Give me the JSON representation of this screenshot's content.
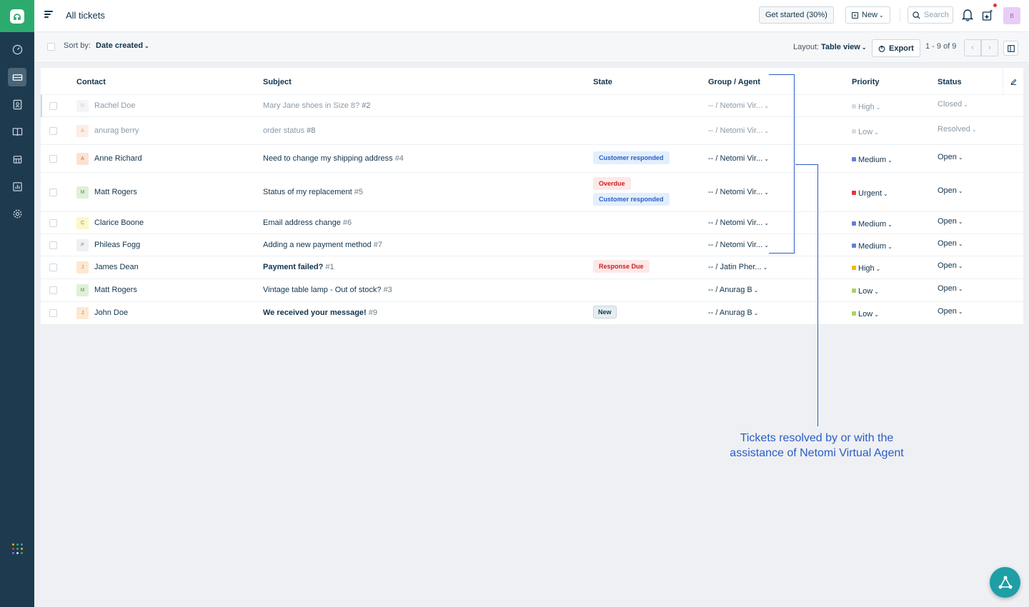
{
  "header": {
    "title": "All tickets",
    "get_started": "Get started (30%)",
    "new_label": "New",
    "search_placeholder": "Search",
    "avatar_initial": "B"
  },
  "toolbar": {
    "sort_label": "Sort by:",
    "sort_value": "Date created",
    "layout_label": "Layout:",
    "layout_value": "Table view",
    "export_label": "Export",
    "pager": "1 - 9 of 9"
  },
  "table": {
    "headers": [
      "Contact",
      "Subject",
      "State",
      "Group / Agent",
      "Priority",
      "Status"
    ],
    "rows": [
      {
        "initial": "R",
        "contact": "Rachel Doe",
        "subject": "Mary Jane shoes in Size 8?",
        "num": "#2",
        "states": [],
        "agent": "-- / Netomi Vir...",
        "priority": "High",
        "status": "Closed"
      },
      {
        "initial": "A",
        "contact": "anurag berry",
        "subject": "order status",
        "num": "#8",
        "states": [],
        "agent": "-- / Netomi Vir...",
        "priority": "Low",
        "status": "Resolved"
      },
      {
        "initial": "A",
        "contact": "Anne Richard",
        "subject": "Need to change my shipping address",
        "num": "#4",
        "states": [
          "Customer responded"
        ],
        "agent": "-- / Netomi Vir...",
        "priority": "Medium",
        "status": "Open"
      },
      {
        "initial": "M",
        "contact": "Matt Rogers",
        "subject": "Status of my replacement",
        "num": "#5",
        "states": [
          "Overdue",
          "Customer responded"
        ],
        "agent": "-- / Netomi Vir...",
        "priority": "Urgent",
        "status": "Open"
      },
      {
        "initial": "C",
        "contact": "Clarice Boone",
        "subject": "Email address change",
        "num": "#6",
        "states": [],
        "agent": "-- / Netomi Vir...",
        "priority": "Medium",
        "status": "Open"
      },
      {
        "initial": "P",
        "contact": "Phileas Fogg",
        "subject": "Adding a new payment method",
        "num": "#7",
        "states": [],
        "agent": "-- / Netomi Vir...",
        "priority": "Medium",
        "status": "Open"
      },
      {
        "initial": "J",
        "contact": "James Dean",
        "subject": "Payment failed?",
        "num": "#1",
        "states": [
          "Response Due"
        ],
        "agent": "-- / Jatin Pher...",
        "priority": "High",
        "status": "Open"
      },
      {
        "initial": "M",
        "contact": "Matt Rogers",
        "subject": "Vintage table lamp - Out of stock?",
        "num": "#3",
        "states": [],
        "agent": "-- / Anurag B",
        "priority": "Low",
        "status": "Open"
      },
      {
        "initial": "J",
        "contact": "John Doe",
        "subject": "We received your message!",
        "num": "#9",
        "states": [
          "New"
        ],
        "agent": "-- / Anurag B",
        "priority": "Low",
        "status": "Open"
      }
    ]
  },
  "annotation": {
    "line1": "Tickets resolved by or with the",
    "line2": "assistance of Netomi Virtual Agent"
  },
  "colors": {
    "brand_green": "#2dab6f",
    "sidebar": "#1e3a4f",
    "annotation_blue": "#2c5cc5",
    "priority_high": "#f5b800",
    "priority_low": "#a9d45c",
    "priority_medium": "#5b84d8",
    "priority_urgent": "#e43538"
  },
  "icons": [
    "ticket-logo-icon",
    "dashboard-icon",
    "tickets-icon",
    "contacts-icon",
    "solutions-icon",
    "bot-icon",
    "reports-icon",
    "settings-icon",
    "apps-icon",
    "bell-icon",
    "sparkle-icon",
    "search-icon",
    "export-icon",
    "edit-icon"
  ]
}
